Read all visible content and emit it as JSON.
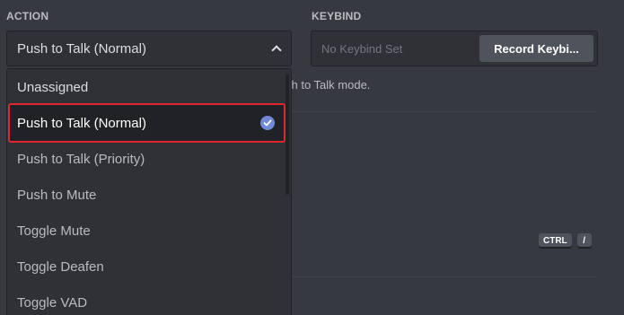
{
  "action": {
    "label": "ACTION",
    "selected_value": "Push to Talk (Normal)",
    "options": [
      {
        "label": "Unassigned"
      },
      {
        "label": "Push to Talk (Normal)",
        "selected": true
      },
      {
        "label": "Push to Talk (Priority)"
      },
      {
        "label": "Push to Mute"
      },
      {
        "label": "Toggle Mute"
      },
      {
        "label": "Toggle Deafen"
      },
      {
        "label": "Toggle VAD"
      }
    ]
  },
  "keybind": {
    "label": "KEYBIND",
    "placeholder": "No Keybind Set",
    "record_button": "Record Keybi..."
  },
  "help_text": "sh to Talk mode.",
  "shortcut": {
    "keys": [
      "CTRL",
      "/"
    ]
  },
  "colors": {
    "background": "#36393f",
    "input_bg": "#2f3136",
    "selected_bg": "#202225",
    "highlight_border": "#e0272d",
    "accent": "#7289da"
  },
  "icons": {
    "select_chevron": "chevron-up-icon",
    "selected_check": "check-circle-icon"
  }
}
